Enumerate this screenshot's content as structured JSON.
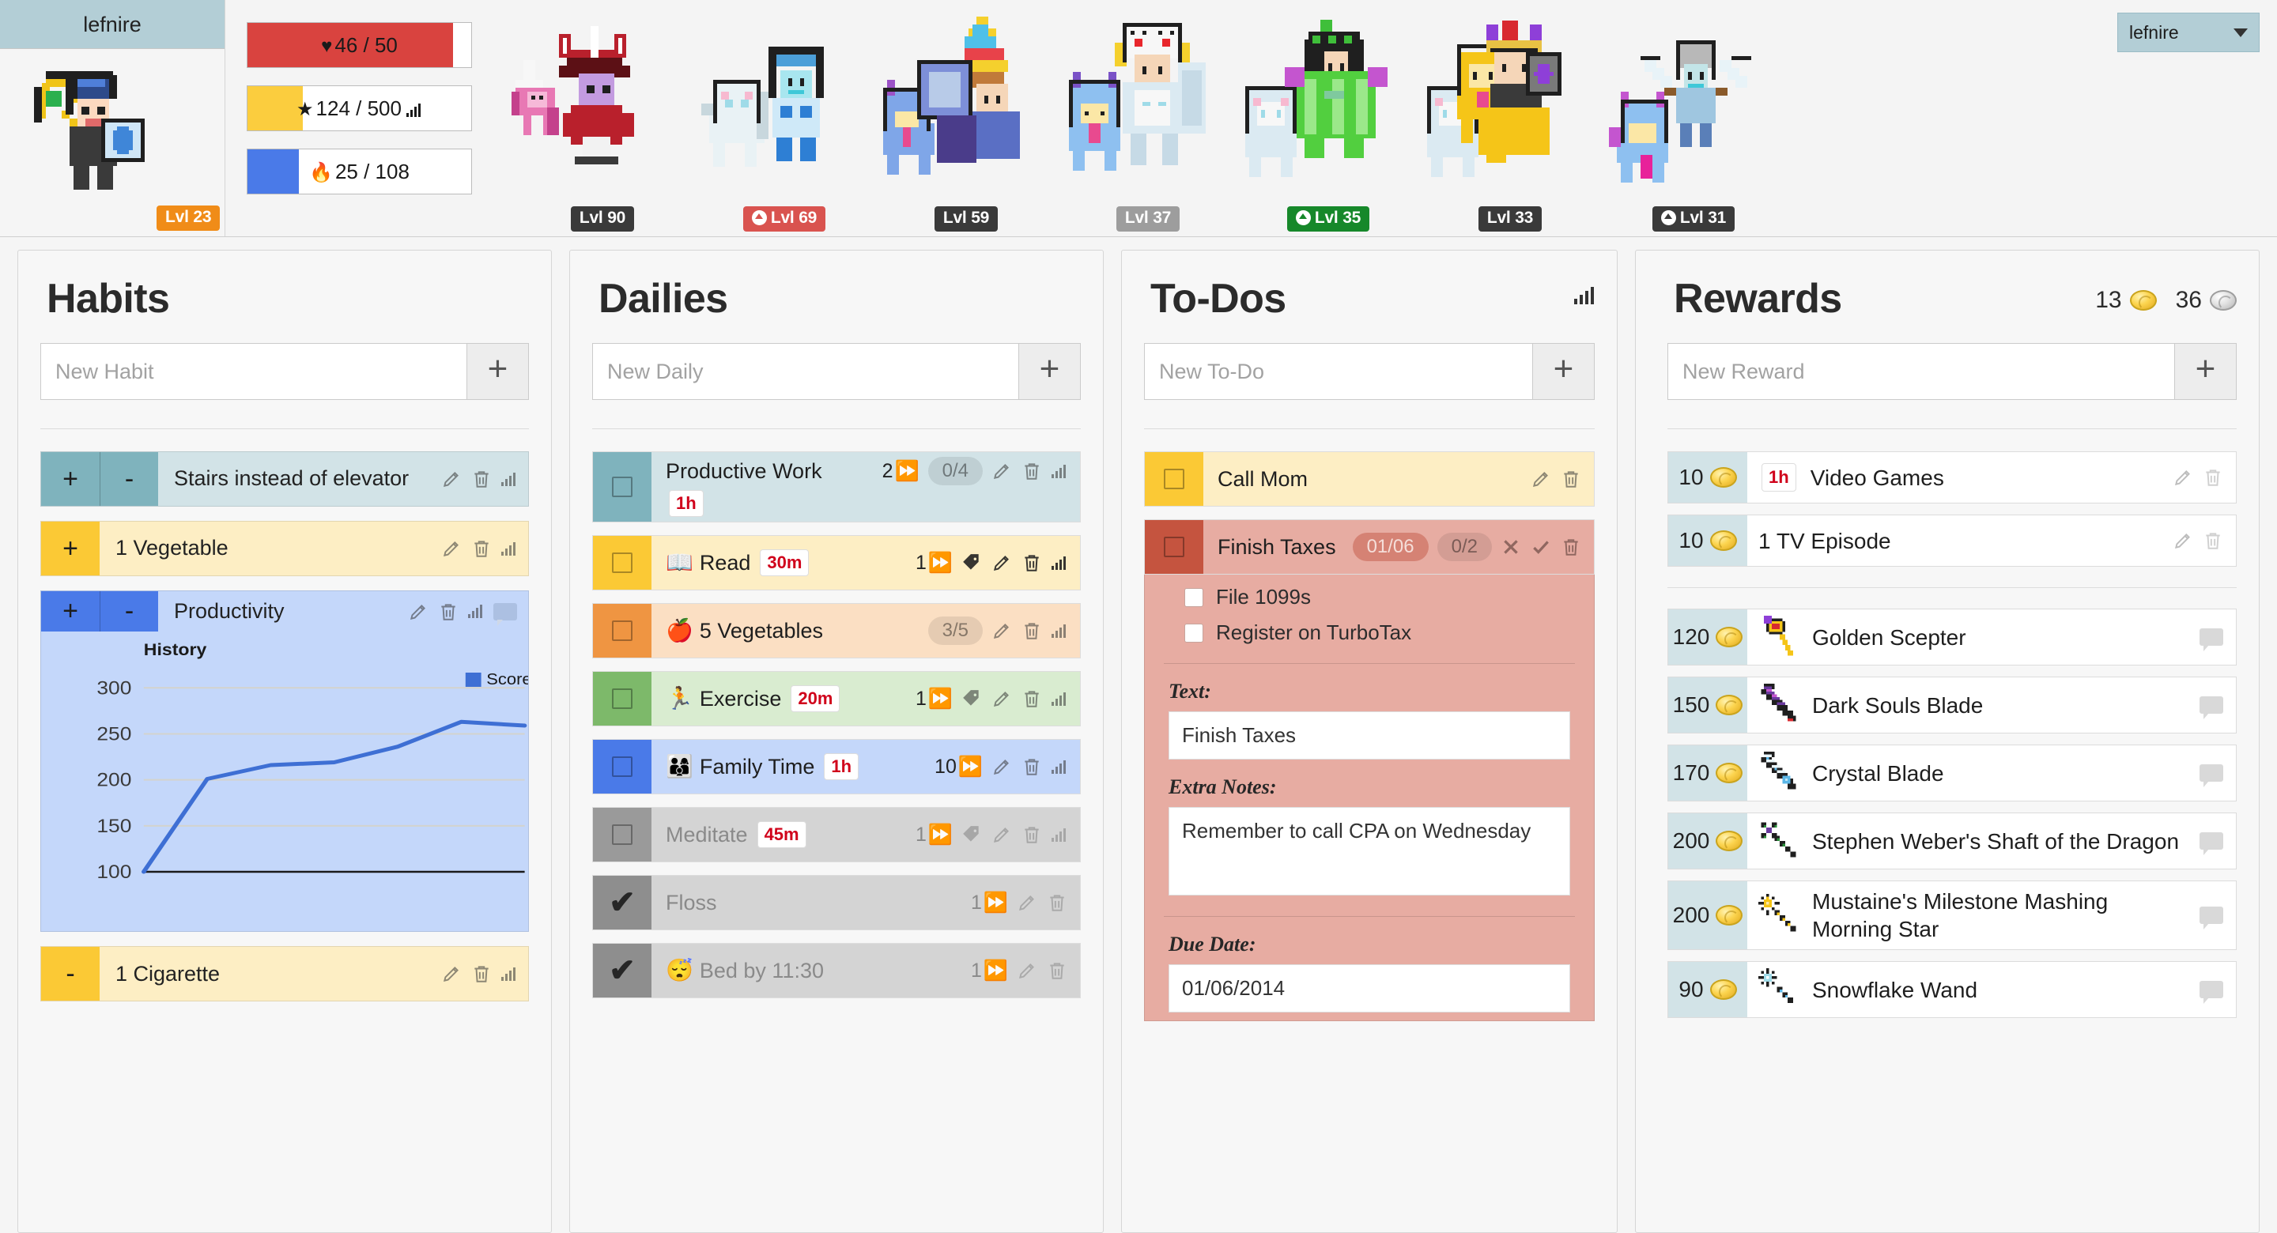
{
  "header": {
    "user": {
      "name": "lefnire",
      "level_label": "Lvl 23"
    },
    "stats": [
      {
        "id": "hp",
        "glyph": "♥",
        "text": "46 / 50",
        "fill_pct": 92,
        "color": "#d9433f",
        "has_chart_icon": false
      },
      {
        "id": "exp",
        "glyph": "★",
        "text": "124 / 500",
        "fill_pct": 24.8,
        "color": "#fbcd3e",
        "has_chart_icon": true
      },
      {
        "id": "mp",
        "glyph": "🔥",
        "text": "25 / 108",
        "fill_pct": 23.1,
        "color": "#4a7ae8",
        "has_chart_icon": false
      }
    ],
    "party": [
      {
        "level_label": "Lvl 90",
        "badge_style": "dark",
        "leveled_up": false
      },
      {
        "level_label": "Lvl 69",
        "badge_style": "red",
        "leveled_up": true
      },
      {
        "level_label": "Lvl 59",
        "badge_style": "dark",
        "leveled_up": false
      },
      {
        "level_label": "Lvl 37",
        "badge_style": "gray",
        "leveled_up": false
      },
      {
        "level_label": "Lvl 35",
        "badge_style": "green",
        "leveled_up": true
      },
      {
        "level_label": "Lvl 33",
        "badge_style": "dark",
        "leveled_up": false
      },
      {
        "level_label": "Lvl 31",
        "badge_style": "dark",
        "leveled_up": true
      }
    ],
    "user_menu": {
      "label": "lefnire"
    }
  },
  "habits": {
    "title": "Habits",
    "new_placeholder": "New Habit",
    "add_label": "+",
    "items": [
      {
        "text": "Stairs instead of elevator",
        "color": "teal",
        "has_plus": true,
        "has_minus": true,
        "icons": [
          "edit",
          "delete",
          "chart"
        ]
      },
      {
        "text": "1 Vegetable",
        "color": "yellow",
        "has_plus": true,
        "has_minus": false,
        "icons": [
          "edit",
          "delete",
          "chart"
        ]
      },
      {
        "text": "Productivity",
        "color": "blue",
        "has_plus": true,
        "has_minus": true,
        "icons": [
          "edit",
          "delete",
          "chart",
          "chat"
        ],
        "expanded_chart": true
      },
      {
        "text": "1 Cigarette",
        "color": "yellow",
        "has_plus": false,
        "has_minus": true,
        "icons": [
          "edit",
          "delete",
          "chart"
        ]
      }
    ]
  },
  "chart_data": {
    "type": "line",
    "title": "History",
    "legend": [
      "Score"
    ],
    "legend_position": "top-right",
    "series": [
      {
        "name": "Score",
        "color": "#3e6fd4",
        "values": [
          100,
          201,
          216,
          219,
          236,
          263,
          259
        ]
      }
    ],
    "x": [
      1,
      2,
      3,
      4,
      5,
      6,
      7
    ],
    "ytick_labels": [
      "100",
      "150",
      "200",
      "250",
      "300"
    ],
    "yticks": [
      100,
      150,
      200,
      250,
      300
    ],
    "ylim": [
      100,
      320
    ],
    "xlabel": "",
    "ylabel": "",
    "grid": true
  },
  "dailies": {
    "title": "Dailies",
    "new_placeholder": "New Daily",
    "add_label": "+",
    "items": [
      {
        "text": "Productive Work",
        "emoji": "",
        "color": "teal",
        "checked": false,
        "dimmed": false,
        "time": "1h",
        "time_below": true,
        "streak": "2",
        "pill": "0/4",
        "icons": [
          "edit",
          "delete",
          "chart"
        ]
      },
      {
        "text": "Read",
        "emoji": "📖",
        "color": "yellow",
        "checked": false,
        "dimmed": false,
        "time": "30m",
        "time_below": false,
        "streak": "1",
        "pill": "",
        "icons": [
          "tag",
          "edit",
          "delete",
          "chart"
        ]
      },
      {
        "text": "5 Vegetables",
        "emoji": "🍎",
        "color": "orange",
        "checked": false,
        "dimmed": false,
        "time": "",
        "time_below": false,
        "streak": "",
        "pill": "3/5",
        "icons": [
          "edit",
          "delete",
          "chart"
        ]
      },
      {
        "text": "Exercise",
        "emoji": "🏃",
        "color": "green",
        "checked": false,
        "dimmed": false,
        "time": "20m",
        "time_below": false,
        "streak": "1",
        "pill": "",
        "icons": [
          "tag",
          "edit",
          "delete",
          "chart"
        ]
      },
      {
        "text": "Family Time",
        "emoji": "👨‍👩‍👦",
        "color": "blue",
        "checked": false,
        "dimmed": false,
        "time": "1h",
        "time_below": false,
        "streak": "10",
        "pill": "",
        "icons": [
          "edit",
          "delete",
          "chart"
        ]
      },
      {
        "text": "Meditate",
        "emoji": "",
        "color": "gray",
        "checked": false,
        "dimmed": true,
        "time": "45m",
        "time_below": false,
        "streak": "1",
        "pill": "",
        "icons": [
          "tag",
          "edit",
          "delete",
          "chart"
        ]
      },
      {
        "text": "Floss",
        "emoji": "",
        "color": "done",
        "checked": true,
        "dimmed": true,
        "time": "",
        "time_below": false,
        "streak": "1",
        "pill": "",
        "icons": [
          "edit",
          "delete"
        ]
      },
      {
        "text": "Bed by 11:30",
        "emoji": "😴",
        "color": "done",
        "checked": true,
        "dimmed": true,
        "time": "",
        "time_below": false,
        "streak": "1",
        "pill": "",
        "icons": [
          "edit",
          "delete"
        ]
      }
    ]
  },
  "todos": {
    "title": "To-Dos",
    "new_placeholder": "New To-Do",
    "add_label": "+",
    "items": [
      {
        "text": "Call Mom",
        "color": "yellow",
        "checked": false,
        "due": "",
        "pill": "",
        "icons": [
          "edit",
          "delete"
        ]
      },
      {
        "text": "Finish Taxes",
        "color": "red",
        "checked": false,
        "due": "01/06",
        "pill": "0/2",
        "icons": [
          "cancel",
          "save",
          "delete"
        ]
      }
    ],
    "expanded": {
      "checklist": [
        {
          "label": "File 1099s",
          "checked": false
        },
        {
          "label": "Register on TurboTax",
          "checked": false
        }
      ],
      "text_label": "Text:",
      "text_value": "Finish Taxes",
      "notes_label": "Extra Notes:",
      "notes_value": "Remember to call CPA on Wednesday",
      "due_label": "Due Date:",
      "due_value": "01/06/2014"
    }
  },
  "rewards": {
    "title": "Rewards",
    "gold": "13",
    "silver": "36",
    "new_placeholder": "New Reward",
    "add_label": "+",
    "custom": [
      {
        "cost": "10",
        "text": "Video Games",
        "time": "1h",
        "icon": "",
        "icons": [
          "edit",
          "delete"
        ]
      },
      {
        "cost": "10",
        "text": "1 TV Episode",
        "time": "",
        "icon": "",
        "icons": [
          "edit",
          "delete"
        ]
      }
    ],
    "equipment": [
      {
        "cost": "120",
        "text": "Golden Scepter",
        "icon": "golden-scepter"
      },
      {
        "cost": "150",
        "text": "Dark Souls Blade",
        "icon": "dark-souls-blade"
      },
      {
        "cost": "170",
        "text": "Crystal Blade",
        "icon": "crystal-blade"
      },
      {
        "cost": "200",
        "text": "Stephen Weber's Shaft of the Dragon",
        "icon": "dragon-shaft"
      },
      {
        "cost": "200",
        "text": "Mustaine's Milestone Mashing Morning Star",
        "icon": "morning-star"
      },
      {
        "cost": "90",
        "text": "Snowflake Wand",
        "icon": "snowflake-wand"
      }
    ]
  }
}
